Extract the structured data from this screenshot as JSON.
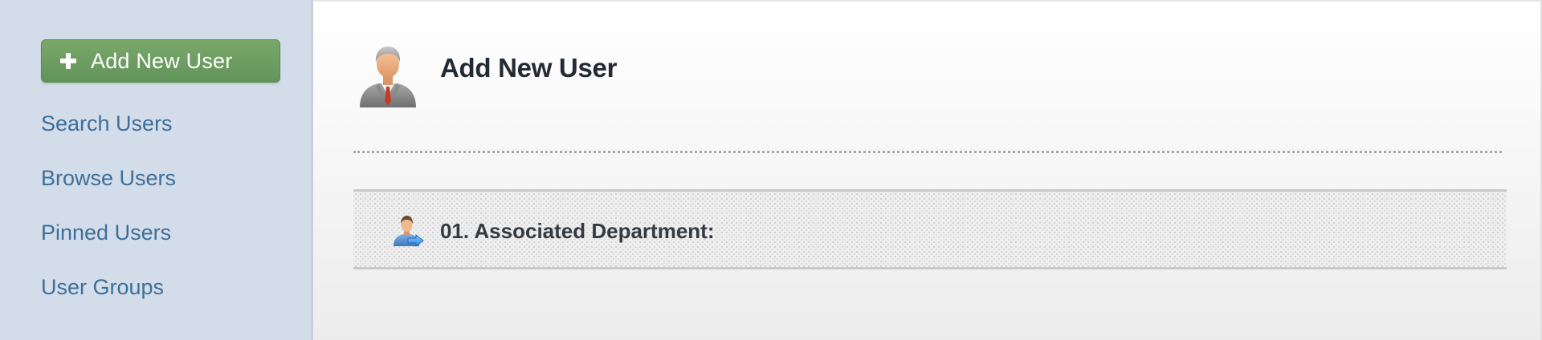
{
  "sidebar": {
    "add_button_label": "Add New User",
    "nav": [
      {
        "label": "Search Users"
      },
      {
        "label": "Browse Users"
      },
      {
        "label": "Pinned Users"
      },
      {
        "label": "User Groups"
      }
    ]
  },
  "main": {
    "title": "Add New User",
    "header_icon": "user-avatar-icon",
    "section": {
      "icon": "user-department-icon",
      "title": "01. Associated Department:"
    }
  },
  "colors": {
    "sidebar_bg": "#d3dde9",
    "button_green": "#6a9b5f",
    "link_blue": "#3d6f9a",
    "title_dark": "#222a33"
  }
}
